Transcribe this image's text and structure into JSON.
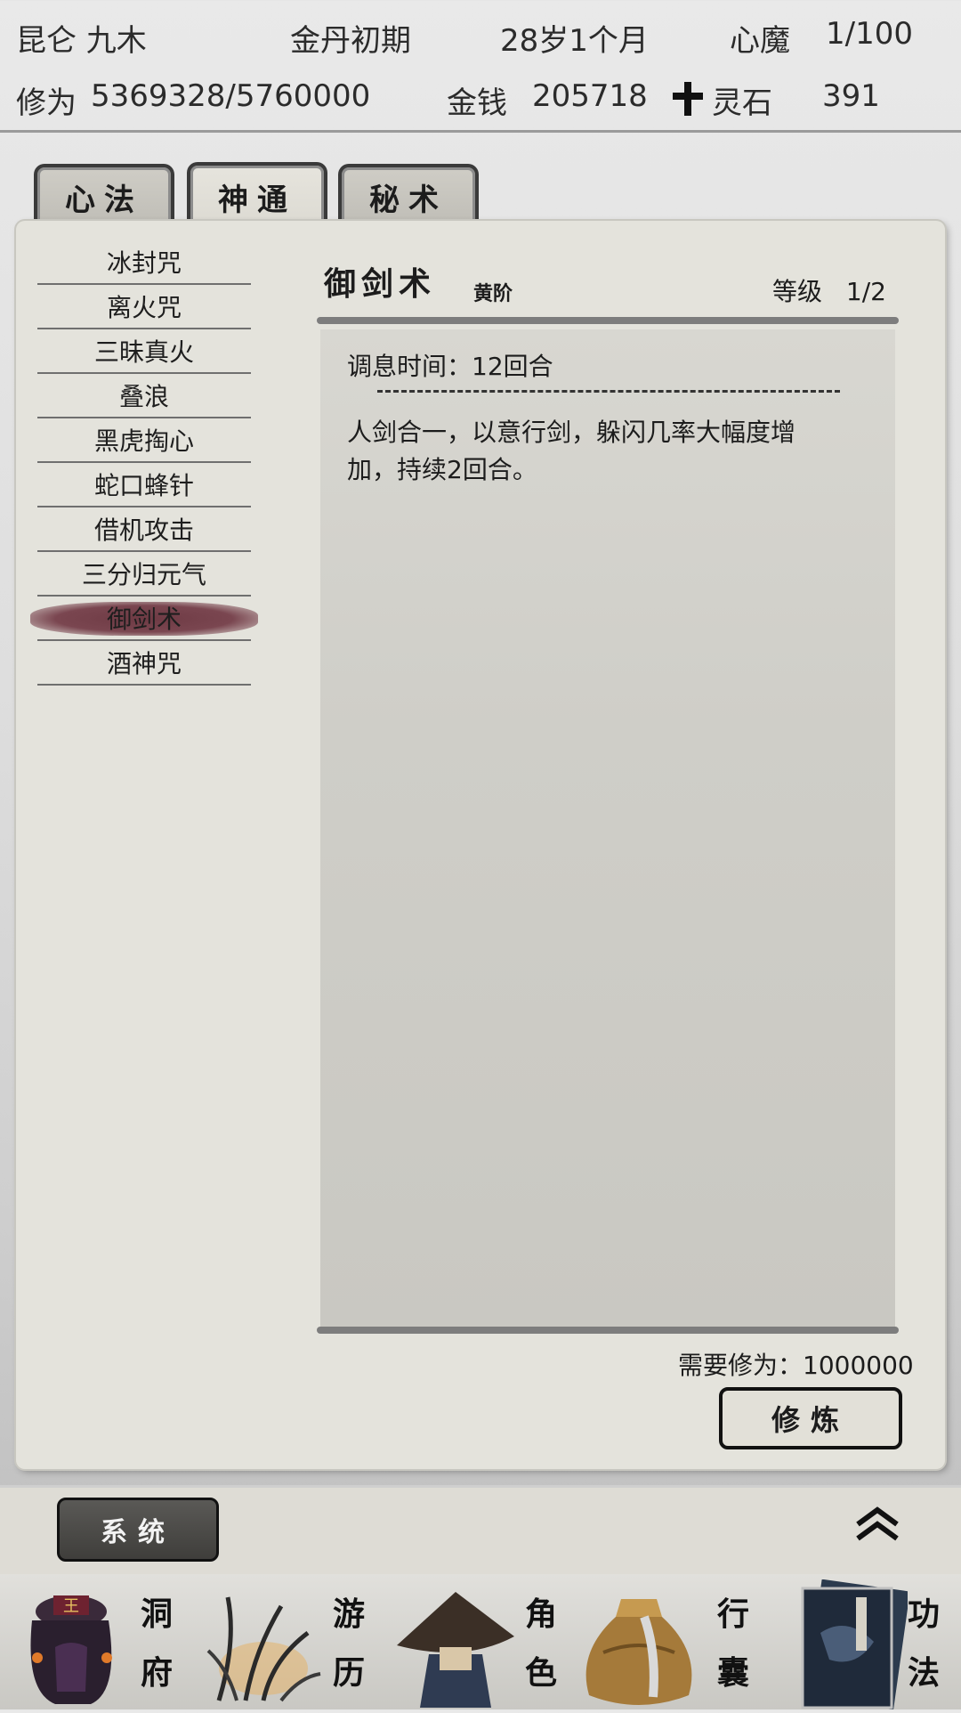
{
  "header": {
    "name": "昆仑 九木",
    "realm": "金丹初期",
    "age": "28岁1个月",
    "demon_label": "心魔",
    "demon_value": "1/100",
    "cultivation_label": "修为",
    "cultivation_value": "5369328/5760000",
    "money_label": "金钱",
    "money_value": "205718",
    "spirit_stone_label": "灵石",
    "spirit_stone_value": "391"
  },
  "tabs": [
    {
      "label": "心法"
    },
    {
      "label": "神通"
    },
    {
      "label": "秘术"
    }
  ],
  "skills": [
    "冰封咒",
    "离火咒",
    "三昧真火",
    "叠浪",
    "黑虎掏心",
    "蛇口蜂针",
    "借机攻击",
    "三分归元气",
    "御剑术",
    "酒神咒"
  ],
  "detail": {
    "title": "御剑术",
    "grade": "黄阶",
    "level_label": "等级",
    "level_value": "1/2",
    "cooldown": "调息时间：12回合",
    "desc_line1": "人剑合一，以意行剑，躲闪几率大幅度增",
    "desc_line2": "加，持续2回合。",
    "required": "需要修为：1000000",
    "practice_label": "修炼"
  },
  "system": {
    "label": "系统"
  },
  "nav": [
    {
      "label_top": "洞",
      "label_bottom": "府"
    },
    {
      "label_top": "游",
      "label_bottom": "历"
    },
    {
      "label_top": "角",
      "label_bottom": "色"
    },
    {
      "label_top": "行",
      "label_bottom": "囊"
    },
    {
      "label_top": "功",
      "label_bottom": "法"
    }
  ]
}
